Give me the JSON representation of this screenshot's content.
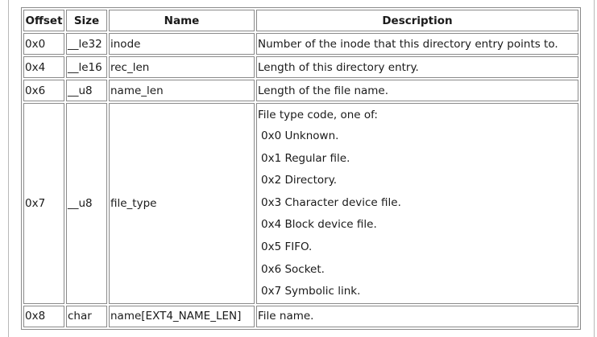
{
  "table": {
    "headers": [
      "Offset",
      "Size",
      "Name",
      "Description"
    ],
    "rows": [
      {
        "offset": "0x0",
        "size": "__le32",
        "name": "inode",
        "description": "Number of the inode that this directory entry points to."
      },
      {
        "offset": "0x4",
        "size": "__le16",
        "name": "rec_len",
        "description": "Length of this directory entry."
      },
      {
        "offset": "0x6",
        "size": "__u8",
        "name": "name_len",
        "description": "Length of the file name."
      },
      {
        "offset": "0x7",
        "size": "__u8",
        "name": "file_type",
        "description": "File type code, one of:",
        "options": [
          "0x0 Unknown.",
          "0x1 Regular file.",
          "0x2 Directory.",
          "0x3 Character device file.",
          "0x4 Block device file.",
          "0x5 FIFO.",
          "0x6 Socket.",
          "0x7 Symbolic link."
        ]
      },
      {
        "offset": "0x8",
        "size": "char",
        "name": "name[EXT4_NAME_LEN]",
        "description": "File name."
      }
    ]
  }
}
